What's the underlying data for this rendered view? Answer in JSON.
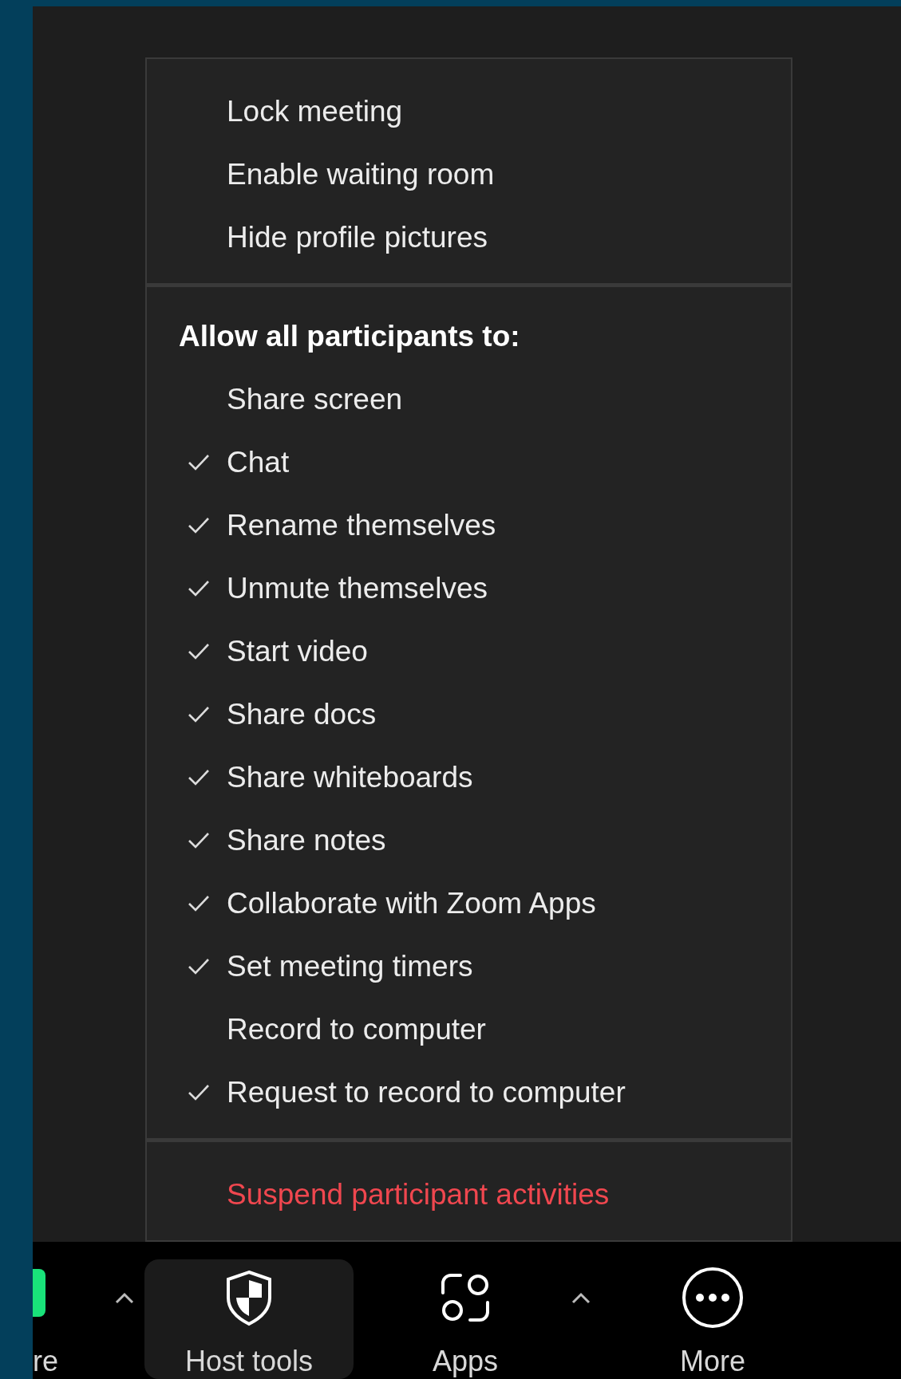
{
  "menu": {
    "sections": [
      {
        "items": [
          {
            "label": "Lock meeting"
          },
          {
            "label": "Enable waiting room"
          },
          {
            "label": "Hide profile pictures"
          }
        ]
      },
      {
        "heading": "Allow all participants to:",
        "items": [
          {
            "label": "Share screen",
            "checked": false
          },
          {
            "label": "Chat",
            "checked": true
          },
          {
            "label": "Rename themselves",
            "checked": true
          },
          {
            "label": "Unmute themselves",
            "checked": true
          },
          {
            "label": "Start video",
            "checked": true
          },
          {
            "label": "Share docs",
            "checked": true
          },
          {
            "label": "Share whiteboards",
            "checked": true
          },
          {
            "label": "Share notes",
            "checked": true
          },
          {
            "label": "Collaborate with Zoom Apps",
            "checked": true
          },
          {
            "label": "Set meeting timers",
            "checked": true
          },
          {
            "label": "Record to computer",
            "checked": false
          },
          {
            "label": "Request to record to computer",
            "checked": true
          }
        ]
      },
      {
        "items": [
          {
            "label": "Suspend participant activities",
            "kind": "danger"
          }
        ]
      }
    ]
  },
  "toolbar": {
    "items": [
      {
        "kind": "partial",
        "label": "re",
        "menu_caret": true,
        "selected": false
      },
      {
        "kind": "host",
        "label": "Host tools",
        "menu_caret": false,
        "selected": true
      },
      {
        "kind": "apps",
        "label": "Apps",
        "menu_caret": true,
        "selected": false
      },
      {
        "kind": "more",
        "label": "More",
        "menu_caret": false,
        "selected": false
      }
    ]
  }
}
